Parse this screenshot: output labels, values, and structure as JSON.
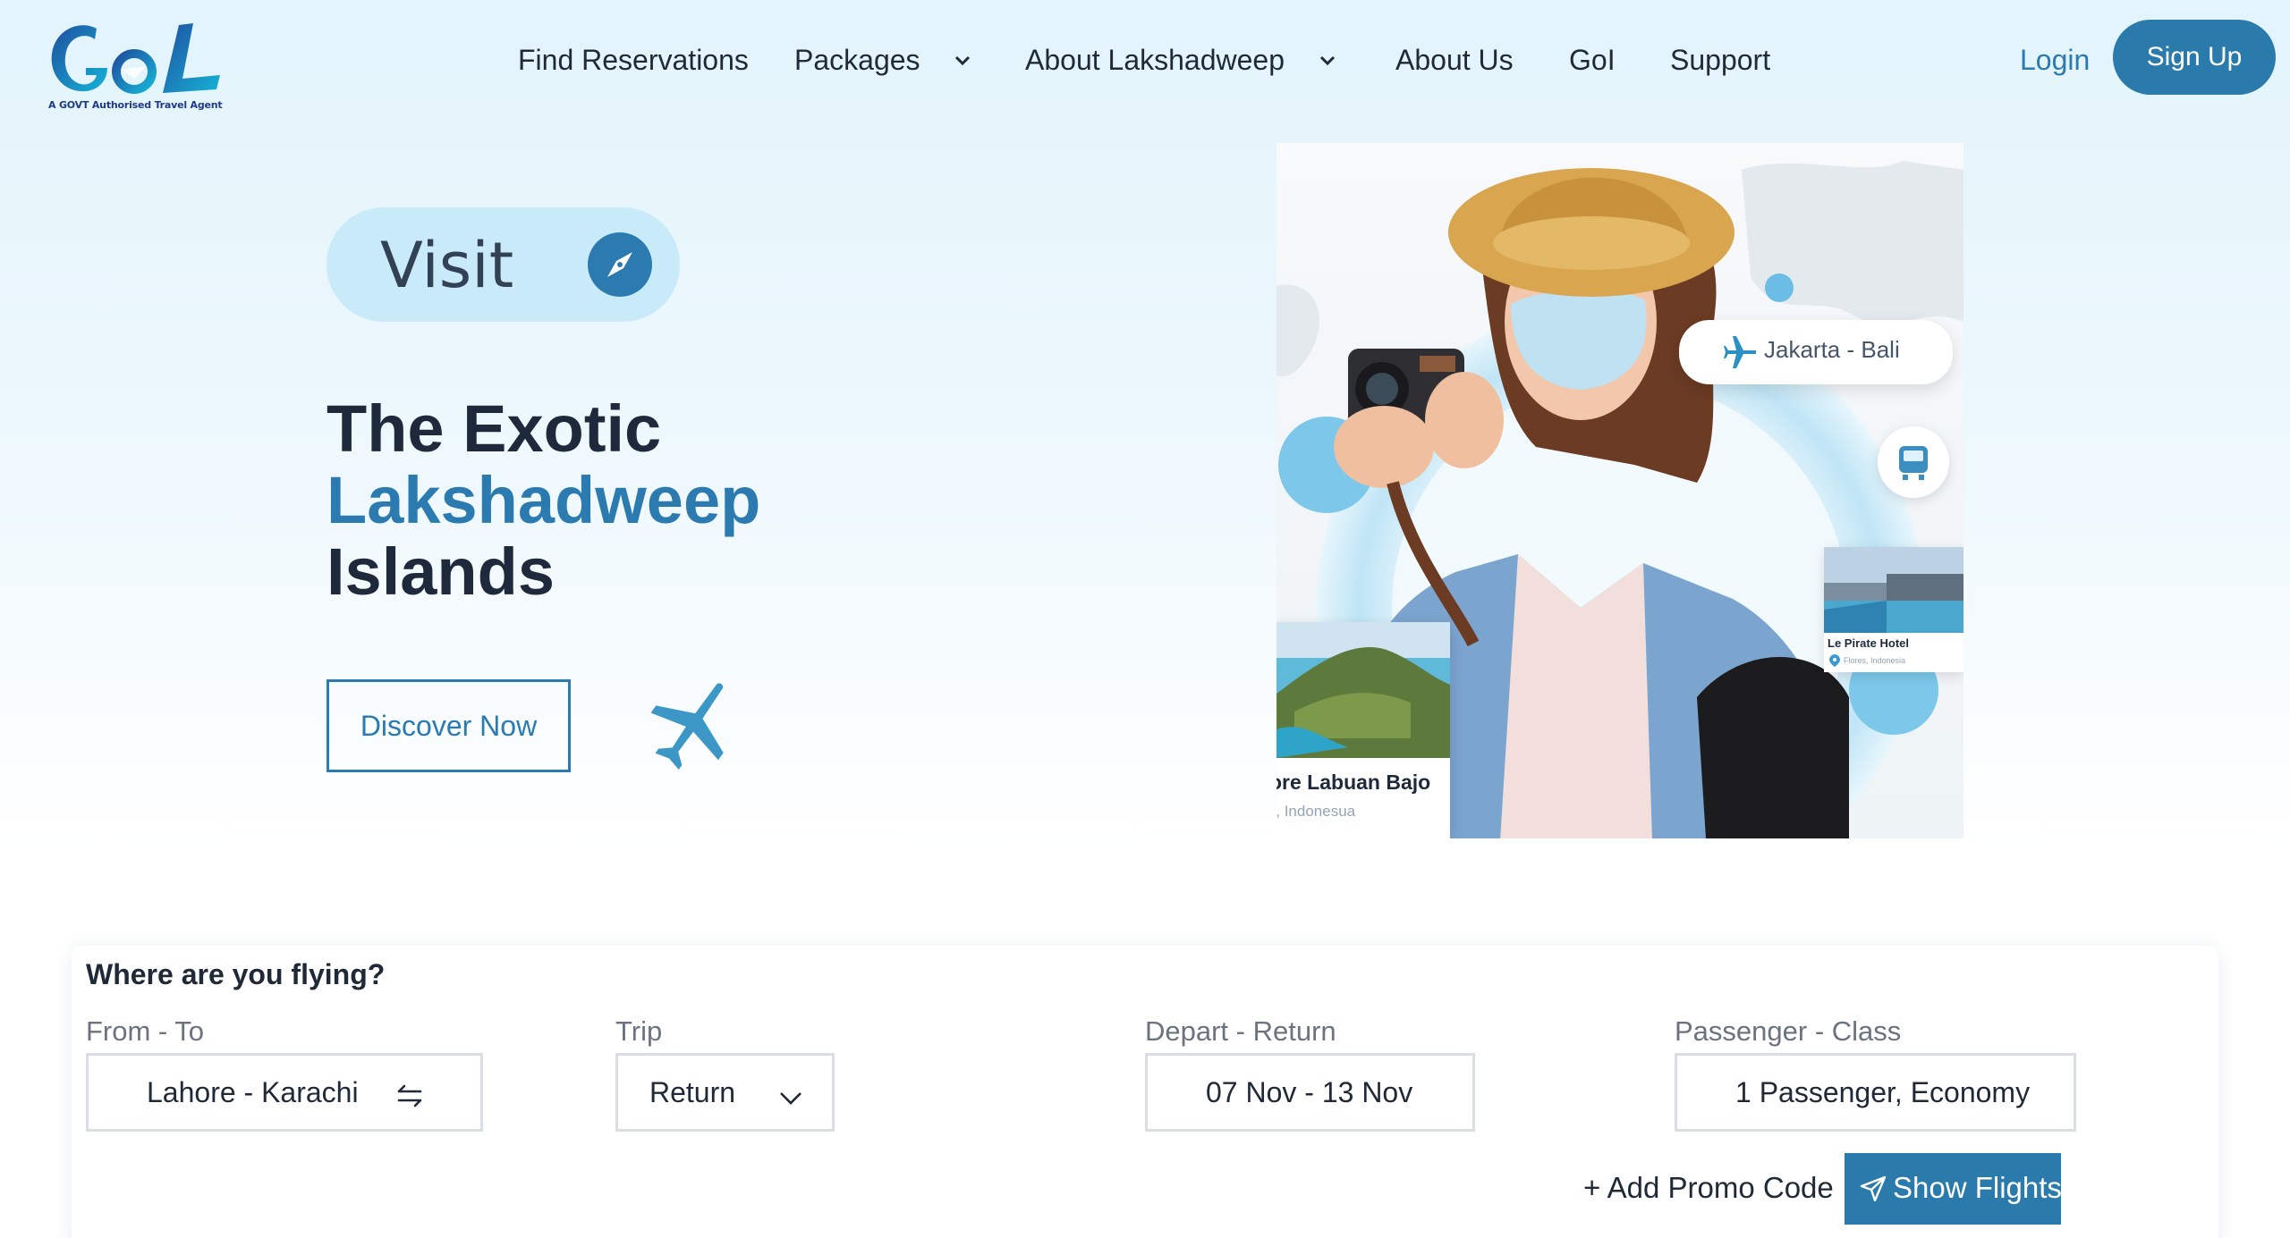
{
  "brand": {
    "name": "GoL",
    "tagline": "A GOVT Authorised Travel Agent",
    "primary_color": "#2a7aab",
    "text_color": "#1e293b"
  },
  "nav": {
    "items": [
      {
        "label": "Find Reservations",
        "dropdown": false
      },
      {
        "label": "Packages",
        "dropdown": true
      },
      {
        "label": "About Lakshadweep",
        "dropdown": true
      },
      {
        "label": "About Us",
        "dropdown": false
      },
      {
        "label": "GoI",
        "dropdown": false
      },
      {
        "label": "Support",
        "dropdown": false
      }
    ],
    "login_label": "Login",
    "signup_label": "Sign Up"
  },
  "hero": {
    "visit_label": "Visit",
    "title_line1": "The Exotic",
    "title_line2": "Lakshadweep",
    "title_line3": "Islands",
    "cta_label": "Discover Now",
    "route_card": "Jakarta - Bali",
    "hotel_card": {
      "name": "Le Pirate Hotel",
      "location": "Flores, Indonesia"
    },
    "island_card": {
      "name": "ore Labuan Bajo",
      "location": "', Indonesua"
    }
  },
  "search": {
    "title": "Where are you flying?",
    "fields": [
      {
        "label": "From - To",
        "value": "Lahore - Karachi",
        "icon": "swap-icon"
      },
      {
        "label": "Trip",
        "value": "Return",
        "icon": "chevron-down-icon"
      },
      {
        "label": "Depart - Return",
        "value": "07 Nov - 13 Nov"
      },
      {
        "label": "Passenger - Class",
        "value": "1 Passenger, Economy"
      }
    ],
    "promo_label": "+ Add Promo Code",
    "submit_label": "Show Flights"
  }
}
